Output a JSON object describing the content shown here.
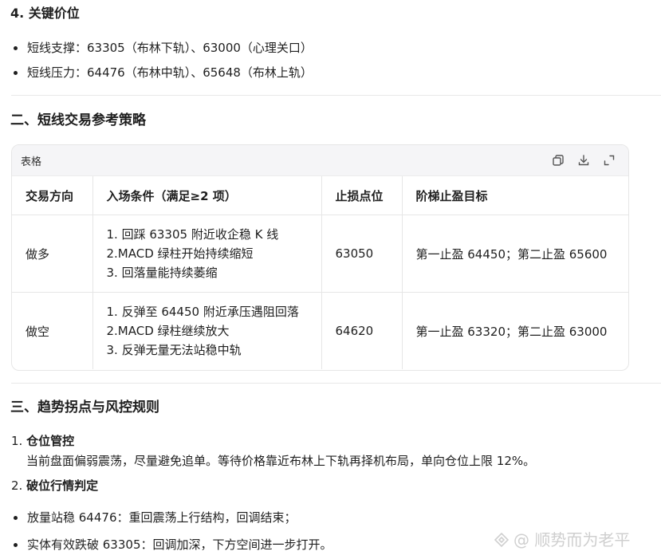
{
  "key_levels": {
    "heading": "4. 关键价位",
    "items": [
      "短线支撑：63305（布林下轨）、63000（心理关口）",
      "短线压力：64476（布林中轨）、65648（布林上轨）"
    ]
  },
  "strategy": {
    "heading": "二、短线交易参考策略",
    "table_label": "表格",
    "icons": [
      "copy-icon",
      "download-icon",
      "expand-icon"
    ],
    "columns": [
      "交易方向",
      "入场条件（满足≥2 项）",
      "止损点位",
      "阶梯止盈目标"
    ],
    "rows": [
      {
        "direction": "做多",
        "conditions": [
          "1. 回踩 63305 附近收企稳 K 线",
          "2.MACD 绿柱开始持续缩短",
          "3. 回落量能持续萎缩"
        ],
        "stop": "63050",
        "targets": "第一止盈 64450；第二止盈 65600"
      },
      {
        "direction": "做空",
        "conditions": [
          "1. 反弹至 64450 附近承压遇阻回落",
          "2.MACD 绿柱继续放大",
          "3. 反弹无量无法站稳中轨"
        ],
        "stop": "64620",
        "targets": "第一止盈 63320；第二止盈 63000"
      }
    ]
  },
  "risk": {
    "heading": "三、趋势拐点与风控规则",
    "item1_num": "1.",
    "item1_title": "仓位管控",
    "item1_body": "当前盘面偏弱震荡，尽量避免追单。等待价格靠近布林上下轨再择机布局，单向仓位上限 12%。",
    "item2_num": "2.",
    "item2_title": "破位行情判定",
    "bullets": [
      "放量站稳 64476：重回震荡上行结构，回调结束；",
      "实体有效跌破 63305：回调加深，下方空间进一步打开。"
    ]
  },
  "watermark": {
    "text": "@ 顺势而为老平"
  }
}
